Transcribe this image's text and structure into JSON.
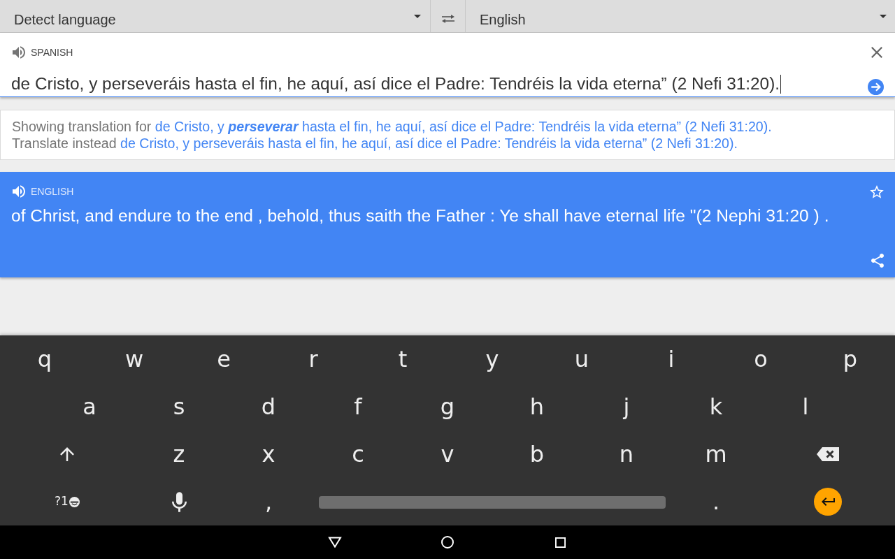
{
  "language_bar": {
    "source_language": "Detect language",
    "target_language": "English"
  },
  "source": {
    "language": "SPANISH",
    "text": "de Cristo, y perseveráis hasta el fin, he aquí, así dice el Padre: Tendréis la vida eterna” (2 Nefi 31:20)."
  },
  "suggestions": [
    {
      "prefix": "Showing translation for",
      "link": "de Cristo, y *perseverar* hasta el fin, he aquí, así dice el Padre: Tendréis la vida eterna” (2 Nefi 31:20)."
    },
    {
      "prefix": "Translate instead",
      "link": "de Cristo, y perseveráis hasta el fin, he aquí, así dice el Padre: Tendréis la vida eterna” (2 Nefi 31:20)."
    }
  ],
  "translation": {
    "language": "ENGLISH",
    "text": "of Christ, and endure to the end , behold, thus saith the Father : Ye shall have eternal life \"(2 Nephi 31:20 ) ."
  },
  "keyboard": {
    "rows": [
      {
        "keys": [
          {
            "kind": "letter",
            "label": "q"
          },
          {
            "kind": "letter",
            "label": "w"
          },
          {
            "kind": "letter",
            "label": "e"
          },
          {
            "kind": "letter",
            "label": "r"
          },
          {
            "kind": "letter",
            "label": "t"
          },
          {
            "kind": "letter",
            "label": "y"
          },
          {
            "kind": "letter",
            "label": "u"
          },
          {
            "kind": "letter",
            "label": "i"
          },
          {
            "kind": "letter",
            "label": "o"
          },
          {
            "kind": "letter",
            "label": "p"
          }
        ]
      },
      {
        "keys": [
          {
            "kind": "letter",
            "label": "a"
          },
          {
            "kind": "letter",
            "label": "s"
          },
          {
            "kind": "letter",
            "label": "d"
          },
          {
            "kind": "letter",
            "label": "f"
          },
          {
            "kind": "letter",
            "label": "g"
          },
          {
            "kind": "letter",
            "label": "h"
          },
          {
            "kind": "letter",
            "label": "j"
          },
          {
            "kind": "letter",
            "label": "k"
          },
          {
            "kind": "letter",
            "label": "l"
          }
        ]
      },
      {
        "keys": [
          {
            "kind": "shift"
          },
          {
            "kind": "letter",
            "label": "z"
          },
          {
            "kind": "letter",
            "label": "x"
          },
          {
            "kind": "letter",
            "label": "c"
          },
          {
            "kind": "letter",
            "label": "v"
          },
          {
            "kind": "letter",
            "label": "b"
          },
          {
            "kind": "letter",
            "label": "n"
          },
          {
            "kind": "letter",
            "label": "m"
          },
          {
            "kind": "backspace"
          }
        ]
      },
      {
        "keys": [
          {
            "kind": "symbols",
            "label": "?1"
          },
          {
            "kind": "mic"
          },
          {
            "kind": "letter",
            "label": ","
          },
          {
            "kind": "space"
          },
          {
            "kind": "letter",
            "label": "."
          },
          {
            "kind": "enter"
          }
        ]
      }
    ]
  }
}
